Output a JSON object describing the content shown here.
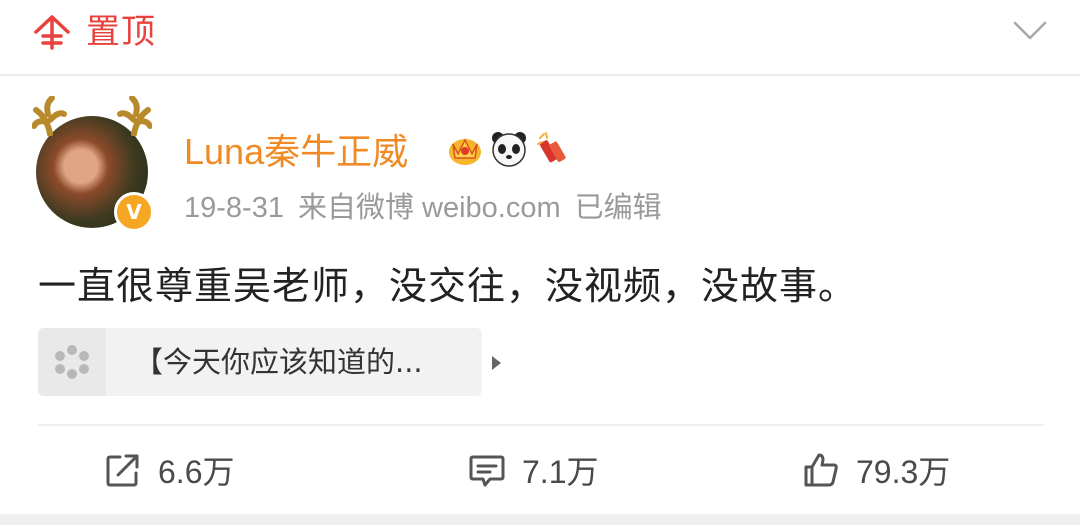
{
  "header": {
    "pin_label": "置顶",
    "pin_icon": "pin-top-icon",
    "expand_icon": "chevron-down-icon",
    "accent_color": "#e8423d"
  },
  "post": {
    "author": {
      "name": "Luna秦牛正威",
      "name_color": "#f08a25",
      "verified_badge": "V",
      "badge_icons": [
        "crown-icon",
        "panda-icon",
        "firecracker-icon"
      ]
    },
    "meta": {
      "date": "19-8-31",
      "source": "来自微博 weibo.com",
      "edited": "已编辑"
    },
    "text": "一直很尊重吴老师，没交往，没视频，没故事。",
    "link_card": {
      "text": "【今天你应该知道的...",
      "icon": "weibo-link-icon"
    }
  },
  "actions": {
    "repost": {
      "count": "6.6万",
      "icon": "share-icon"
    },
    "comment": {
      "count": "7.1万",
      "icon": "comment-icon"
    },
    "like": {
      "count": "79.3万",
      "icon": "thumbs-up-icon"
    }
  }
}
